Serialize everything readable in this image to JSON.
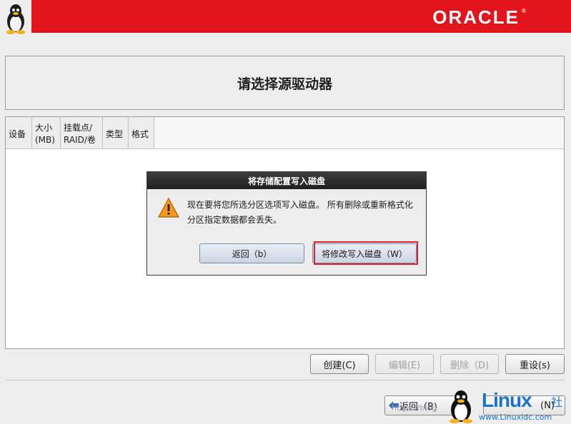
{
  "banner": {
    "brand": "ORACLE",
    "reg_mark": "®"
  },
  "page": {
    "title": "请选择源驱动器"
  },
  "table": {
    "headers": [
      "设备",
      "大小\n(MB)",
      "挂载点/\nRAID/卷",
      "类型",
      "格式"
    ],
    "rows": []
  },
  "actions": {
    "create": "创建(C)",
    "edit": "编辑(E)",
    "delete": "删除（D)",
    "reset": "重设(s)"
  },
  "nav": {
    "back": "返回（B)",
    "next": "(N)"
  },
  "dialog": {
    "title": "将存储配置写入磁盘",
    "message": "现在要将您所选分区选项写入磁盘。 所有删除或重新格式化分区指定数据都会丢失。",
    "back_button": "返回（b）",
    "confirm_button": "将修改写入磁盘（W）"
  },
  "watermark": {
    "brand": "Linux",
    "brand_suffix": "社",
    "url": "www.Linuxidc.com",
    "csdn": "https://blog"
  },
  "colors": {
    "banner": "#e3151c",
    "highlight": "#e0202a",
    "dialog_title": "#2b2b2b"
  }
}
